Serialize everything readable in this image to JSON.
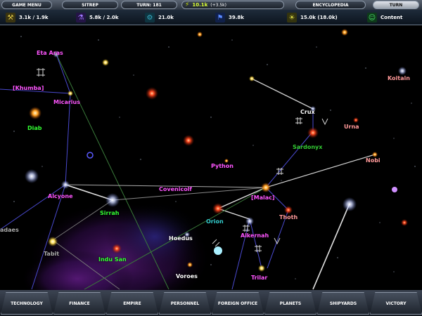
{
  "topbar": {
    "game_menu": "GAME MENU",
    "sitrep": "SITREP",
    "turn_label": "TURN: 181",
    "credits_value": "10.1k",
    "credits_income": "(+3.5k)",
    "encyclopedia": "ENCYCLOPEDIA",
    "turn_button": "TURN"
  },
  "resources": [
    {
      "icon": "industry-icon",
      "value": "3.1k / 1.9k",
      "color": "#e0c84a"
    },
    {
      "icon": "research-icon",
      "value": "5.8k / 2.0k",
      "color": "#7a4ae0"
    },
    {
      "icon": "trade-icon",
      "value": "21.0k",
      "color": "#3ab0c8"
    },
    {
      "icon": "population-icon",
      "value": "39.8k",
      "color": "#3a6ae0"
    },
    {
      "icon": "food-icon",
      "value": "15.0k (18.0k)",
      "color": "#c8c83a"
    },
    {
      "icon": "happiness-icon",
      "value": "Content",
      "color": "#3ac85a"
    }
  ],
  "systems": [
    {
      "name": "Eta Aras",
      "color": "#ff55ff"
    },
    {
      "name": "[Khumba]",
      "color": "#ff55ff"
    },
    {
      "name": "Micarius",
      "color": "#ff55ff"
    },
    {
      "name": "Diab",
      "color": "#33ff33"
    },
    {
      "name": "Alcyone",
      "color": "#ff55ff"
    },
    {
      "name": "Sirrah",
      "color": "#33ff33"
    },
    {
      "name": "adaes",
      "color": "#aaaaaa"
    },
    {
      "name": "Tabit",
      "color": "#aaaaaa"
    },
    {
      "name": "Indu San",
      "color": "#33ff33"
    },
    {
      "name": "Hoedus",
      "color": "#ffffff"
    },
    {
      "name": "Voroes",
      "color": "#ffffff"
    },
    {
      "name": "Python",
      "color": "#ff55ff"
    },
    {
      "name": "Covenicolf",
      "color": "#ff55ff"
    },
    {
      "name": "[Malac]",
      "color": "#ff55ff"
    },
    {
      "name": "Orion",
      "color": "#33cccc"
    },
    {
      "name": "Alkernah",
      "color": "#ff55ff"
    },
    {
      "name": "Trilar",
      "color": "#ff55ff"
    },
    {
      "name": "Thoth",
      "color": "#ff9999"
    },
    {
      "name": "Crux",
      "color": "#ffffff"
    },
    {
      "name": "Sardonyx",
      "color": "#33cc33"
    },
    {
      "name": "Urna",
      "color": "#ff9999"
    },
    {
      "name": "Nobi",
      "color": "#ff9999"
    },
    {
      "name": "Koitain",
      "color": "#ff9999"
    }
  ],
  "bottom_menu": [
    "TECHNOLOGY",
    "FINANCE",
    "EMPIRE",
    "PERSONNEL",
    "FOREIGN OFFICE",
    "PLANETS",
    "SHIPYARDS",
    "VICTORY"
  ]
}
